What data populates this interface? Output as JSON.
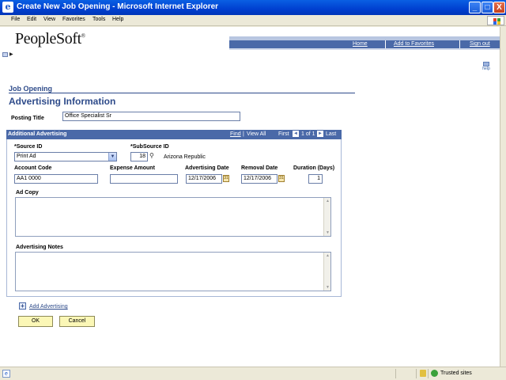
{
  "window": {
    "title": "Create New Job Opening - Microsoft Internet Explorer",
    "min": "_",
    "max": "□",
    "close": "X"
  },
  "menu": [
    "File",
    "Edit",
    "View",
    "Favorites",
    "Tools",
    "Help"
  ],
  "header": {
    "logo": "PeopleSoft",
    "logo_mark": "®",
    "links": {
      "home": "Home",
      "favorites": "Add to Favorites",
      "signout": "Sign out"
    },
    "help": "help"
  },
  "page": {
    "section": "Job Opening",
    "title": "Advertising Information",
    "posting_title_label": "Posting Title",
    "posting_title_value": "Office Specialist Sr"
  },
  "grid": {
    "title": "Additional Advertising",
    "find": "Find",
    "sep": "|",
    "view_all": "View All",
    "first": "First",
    "count": "1 of 1",
    "last": "Last",
    "prev_icon": "◄",
    "next_icon": "►"
  },
  "fields": {
    "source_id_label": "*Source ID",
    "source_id_value": "Print Ad",
    "subsource_id_label": "*SubSource ID",
    "subsource_id_value": "18",
    "subsource_desc": "Arizona Republic",
    "account_code_label": "Account Code",
    "account_code_value": "AA1 0000",
    "expense_amount_label": "Expense Amount",
    "expense_amount_value": "",
    "advertising_date_label": "Advertising Date",
    "advertising_date_value": "12/17/2006",
    "removal_date_label": "Removal Date",
    "removal_date_value": "12/17/2006",
    "duration_label": "Duration (Days)",
    "duration_value": "1",
    "ad_copy_label": "Ad Copy",
    "ad_notes_label": "Advertising Notes"
  },
  "actions": {
    "add_advertising": "Add Advertising",
    "ok": "OK",
    "cancel": "Cancel"
  },
  "status": {
    "zone": "Trusted sites"
  }
}
